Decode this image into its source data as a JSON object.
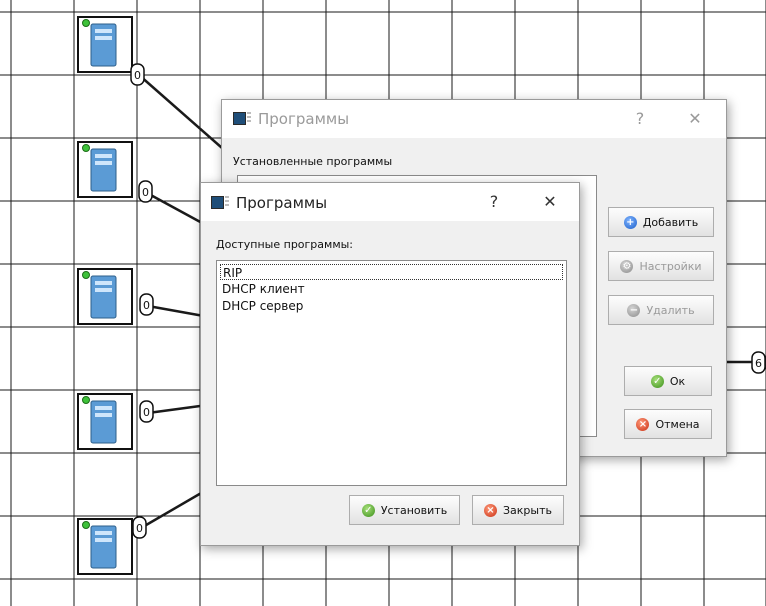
{
  "network": {
    "port_labels": [
      "0",
      "0",
      "0",
      "0",
      "0",
      "6"
    ]
  },
  "installed_dialog": {
    "title": "Программы",
    "help": "?",
    "close": "✕",
    "installed_label": "Установленные программы",
    "buttons": {
      "add": "Добавить",
      "settings": "Настройки",
      "remove": "Удалить",
      "ok": "Ок",
      "cancel": "Отмена"
    }
  },
  "available_dialog": {
    "title": "Программы",
    "help": "?",
    "close": "✕",
    "available_label": "Доступные программы:",
    "programs": [
      "RIP",
      "DHCP клиент",
      "DHCP сервер"
    ],
    "selected_index": 0,
    "buttons": {
      "install": "Установить",
      "close": "Закрыть"
    }
  }
}
